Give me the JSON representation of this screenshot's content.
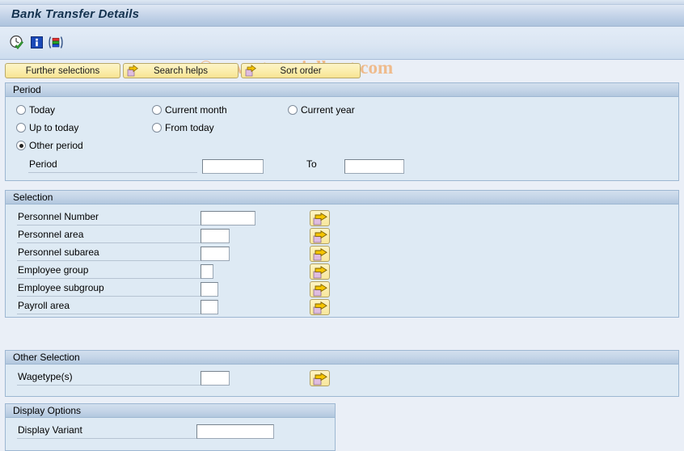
{
  "window": {
    "title": "Bank Transfer Details"
  },
  "watermark": {
    "text": "© www.tutorialkart.com",
    "color": "#f0b27a"
  },
  "toolbar": {
    "icons": [
      {
        "name": "execute-with-variant-icon",
        "glyph": "clock-check"
      },
      {
        "name": "info-icon",
        "glyph": "blue-i"
      },
      {
        "name": "variant-bars-icon",
        "glyph": "color-bars"
      }
    ]
  },
  "buttonbar": {
    "buttons": [
      {
        "name": "further-selections-button",
        "label": "Further selections",
        "has_icon": false
      },
      {
        "name": "search-helps-button",
        "label": "Search helps",
        "has_icon": true
      },
      {
        "name": "sort-order-button",
        "label": "Sort order",
        "has_icon": true
      }
    ]
  },
  "period": {
    "title": "Period",
    "options": [
      {
        "label": "Today",
        "selected": false
      },
      {
        "label": "Current month",
        "selected": false
      },
      {
        "label": "Current year",
        "selected": false
      },
      {
        "label": "Up to today",
        "selected": false
      },
      {
        "label": "From today",
        "selected": false
      },
      {
        "label": "Other period",
        "selected": true
      }
    ],
    "period_label": "Period",
    "period_value": "",
    "to_label": "To",
    "to_value": ""
  },
  "selection": {
    "title": "Selection",
    "rows": [
      {
        "label": "Personnel Number",
        "value": "",
        "input_width": 68
      },
      {
        "label": "Personnel area",
        "value": "",
        "input_width": 36
      },
      {
        "label": "Personnel subarea",
        "value": "",
        "input_width": 36
      },
      {
        "label": "Employee group",
        "value": "",
        "input_width": 16
      },
      {
        "label": "Employee subgroup",
        "value": "",
        "input_width": 22
      },
      {
        "label": "Payroll area",
        "value": "",
        "input_width": 22
      }
    ],
    "multi_select_icon": "multiple-selection-arrow-icon"
  },
  "other_selection": {
    "title": "Other Selection",
    "label": "Wagetype(s)",
    "value": "",
    "multi_select_icon": "multiple-selection-arrow-icon"
  },
  "display_options": {
    "title": "Display Options",
    "label": "Display Variant",
    "value": ""
  },
  "colors": {
    "panel_bg": "#deeaf4",
    "page_bg": "#eaeff7",
    "button_yellow": "#fbeeae",
    "header_blue": "#c3d4e7"
  }
}
